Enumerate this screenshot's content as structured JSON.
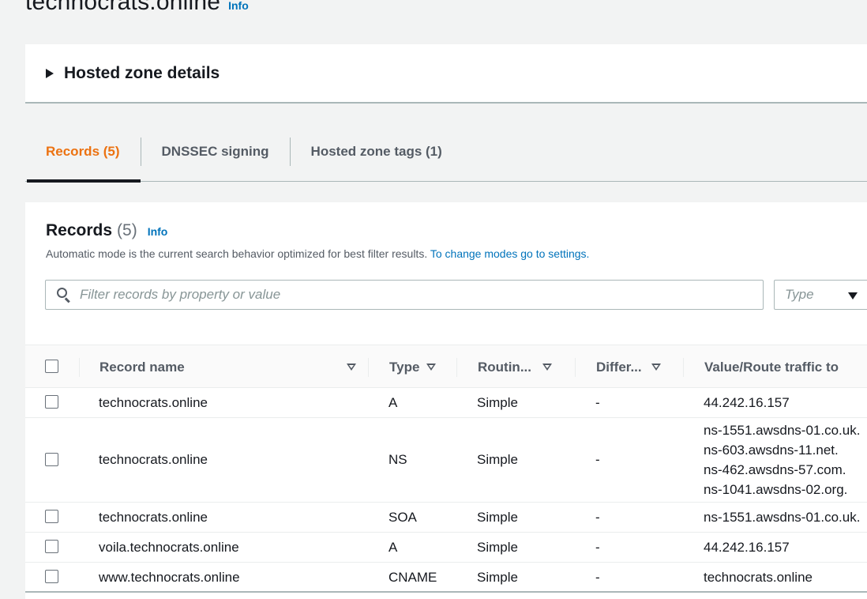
{
  "page": {
    "title": "technocrats.online",
    "info_label": "Info"
  },
  "details": {
    "title": "Hosted zone details"
  },
  "tabs": [
    {
      "label": "Records (5)",
      "active": true
    },
    {
      "label": "DNSSEC signing",
      "active": false
    },
    {
      "label": "Hosted zone tags (1)",
      "active": false
    }
  ],
  "records_panel": {
    "title": "Records",
    "count": "(5)",
    "info_label": "Info",
    "description": "Automatic mode is the current search behavior optimized for best filter results.",
    "settings_link": "To change modes go to settings.",
    "search_placeholder": "Filter records by property or value",
    "type_placeholder": "Type"
  },
  "table": {
    "columns": [
      "Record name",
      "Type",
      "Routin...",
      "Differ...",
      "Value/Route traffic to"
    ],
    "rows": [
      {
        "name": "technocrats.online",
        "type": "A",
        "routing": "Simple",
        "differ": "-",
        "values": [
          "44.242.16.157"
        ]
      },
      {
        "name": "technocrats.online",
        "type": "NS",
        "routing": "Simple",
        "differ": "-",
        "values": [
          "ns-1551.awsdns-01.co.uk.",
          "ns-603.awsdns-11.net.",
          "ns-462.awsdns-57.com.",
          "ns-1041.awsdns-02.org."
        ]
      },
      {
        "name": "technocrats.online",
        "type": "SOA",
        "routing": "Simple",
        "differ": "-",
        "values": [
          "ns-1551.awsdns-01.co.uk."
        ]
      },
      {
        "name": "voila.technocrats.online",
        "type": "A",
        "routing": "Simple",
        "differ": "-",
        "values": [
          "44.242.16.157"
        ]
      },
      {
        "name": "www.technocrats.online",
        "type": "CNAME",
        "routing": "Simple",
        "differ": "-",
        "values": [
          "technocrats.online"
        ]
      }
    ]
  },
  "colors": {
    "accent_tab": "#ec7211",
    "link": "#0073bb",
    "text": "#16191f",
    "background": "#f2f3f3"
  }
}
